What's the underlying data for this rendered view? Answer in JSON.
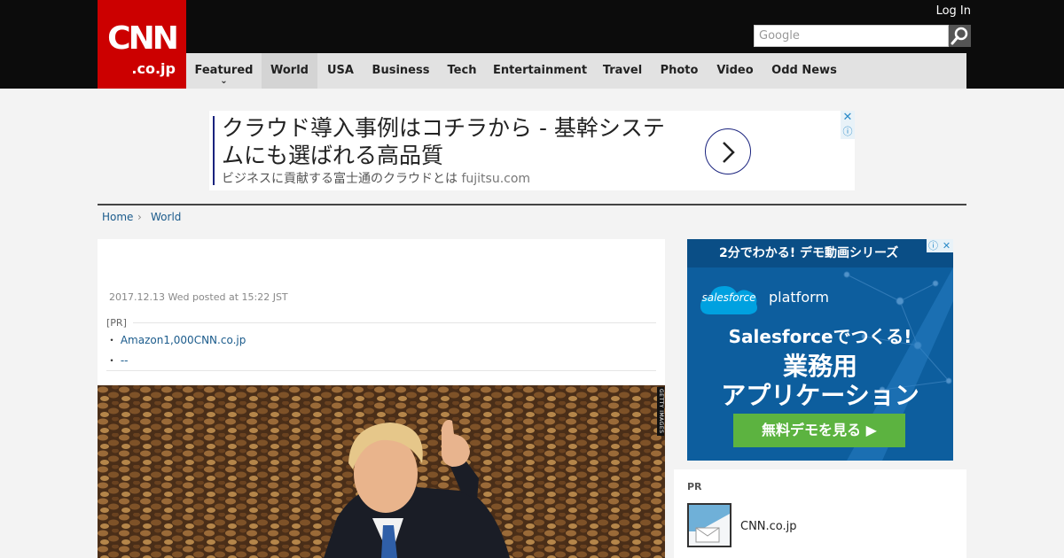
{
  "header": {
    "logo_main": "CNN",
    "logo_sub": ".co.jp",
    "login_label": "Log In",
    "search_placeholder": "Google",
    "search_icon": "search-icon"
  },
  "nav": {
    "items": [
      {
        "label": "Featured"
      },
      {
        "label": "World"
      },
      {
        "label": "USA"
      },
      {
        "label": "Business"
      },
      {
        "label": "Tech"
      },
      {
        "label": "Entertainment"
      },
      {
        "label": "Travel"
      },
      {
        "label": "Photo"
      },
      {
        "label": "Video"
      },
      {
        "label": "Odd News"
      }
    ],
    "active": "World"
  },
  "top_ad": {
    "headline": "クラウド導入事例はコチラから - 基幹システムにも選ばれる高品質",
    "sub": "ビジネスに貢献する富士通のクラウドとは",
    "domain": "fujitsu.com"
  },
  "breadcrumb": {
    "home": "Home",
    "separator": "›",
    "section": "World"
  },
  "article": {
    "posted": "2017.12.13 Wed posted at 15:22 JST",
    "pr_label": "[PR]",
    "pr_links": [
      {
        "bullet": "・",
        "text": "Amazon1,000CNN.co.jp"
      },
      {
        "bullet": "・",
        "text": "--"
      }
    ],
    "photo_credit": "GETTY IMAGES"
  },
  "side_ad": {
    "top_text": "2分でわかる! デモ動画シリーズ",
    "brand": "salesforce",
    "platform": "platform",
    "line1": "Salesforceでつくる!",
    "line2": "業務用",
    "line3": "アプリケーション",
    "cta": "無料デモを見る ▶"
  },
  "pr_box": {
    "label": "PR",
    "item_text": "CNN.co.jp"
  },
  "colors": {
    "brand_red": "#cc0000",
    "header_bg": "#0c0c0c",
    "nav_bg": "#e2e2e2",
    "link": "#1b5b8c",
    "ad_blue": "#0d5e9e",
    "cta_green": "#5cb340"
  }
}
